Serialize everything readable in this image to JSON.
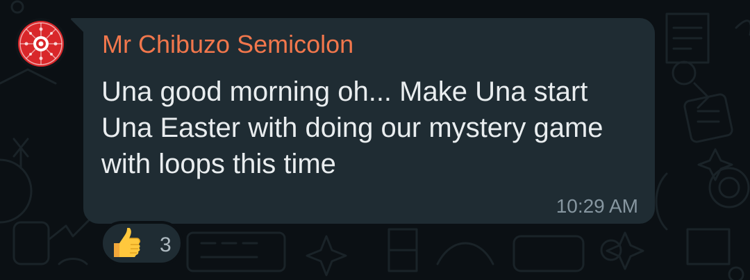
{
  "message": {
    "sender": "Mr Chibuzo Semicolon",
    "text": "Una good morning oh... Make Una start Una Easter with doing our mystery game with loops this time",
    "time": "10:29 AM"
  },
  "reaction": {
    "emoji": "thumbs-up",
    "count": "3"
  },
  "colors": {
    "background": "#0b1014",
    "bubble": "#1f2c33",
    "sender_name": "#f2774c",
    "message_text": "#e9edef",
    "timestamp": "#8696a0",
    "avatar_red": "#d9272a"
  }
}
